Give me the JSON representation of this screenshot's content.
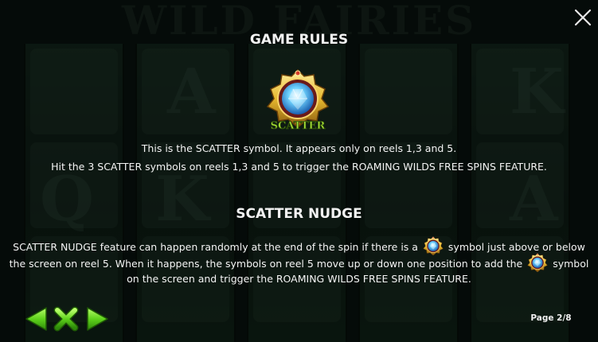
{
  "background": {
    "game_title": "WILD FAIRIES",
    "symbols": [
      "A",
      "K",
      "Q",
      "K",
      "A"
    ]
  },
  "rules": {
    "title": "GAME RULES",
    "scatter_label": "SCATTER",
    "line1": "This is the SCATTER symbol. It appears only on reels 1,3 and 5.",
    "line2": "Hit the 3 SCATTER symbols on reels 1,3 and 5 to trigger the ROAMING WILDS FREE SPINS FEATURE."
  },
  "nudge": {
    "title": "SCATTER NUDGE",
    "line1_a": "SCATTER NUDGE feature can happen randomly at the end of the spin if there is a",
    "line1_b": "symbol just above or below",
    "line2_a": "the screen on reel 5. When it happens, the symbols on reel 5 move up or down one position to add the",
    "line2_b": "symbol",
    "line3": "on the screen and trigger the ROAMING WILDS FREE SPINS FEATURE."
  },
  "navigation": {
    "page_indicator": "Page 2/8"
  },
  "icons": {
    "close": "close-icon",
    "prev": "arrow-left-icon",
    "exit": "x-icon",
    "next": "arrow-right-icon",
    "scatter": "scatter-gem-icon"
  },
  "colors": {
    "nav_green": "#5fd21c",
    "scatter_gold": "#e6b82e",
    "scatter_gem": "#5ec8ff",
    "scatter_text": "#a8e038"
  }
}
